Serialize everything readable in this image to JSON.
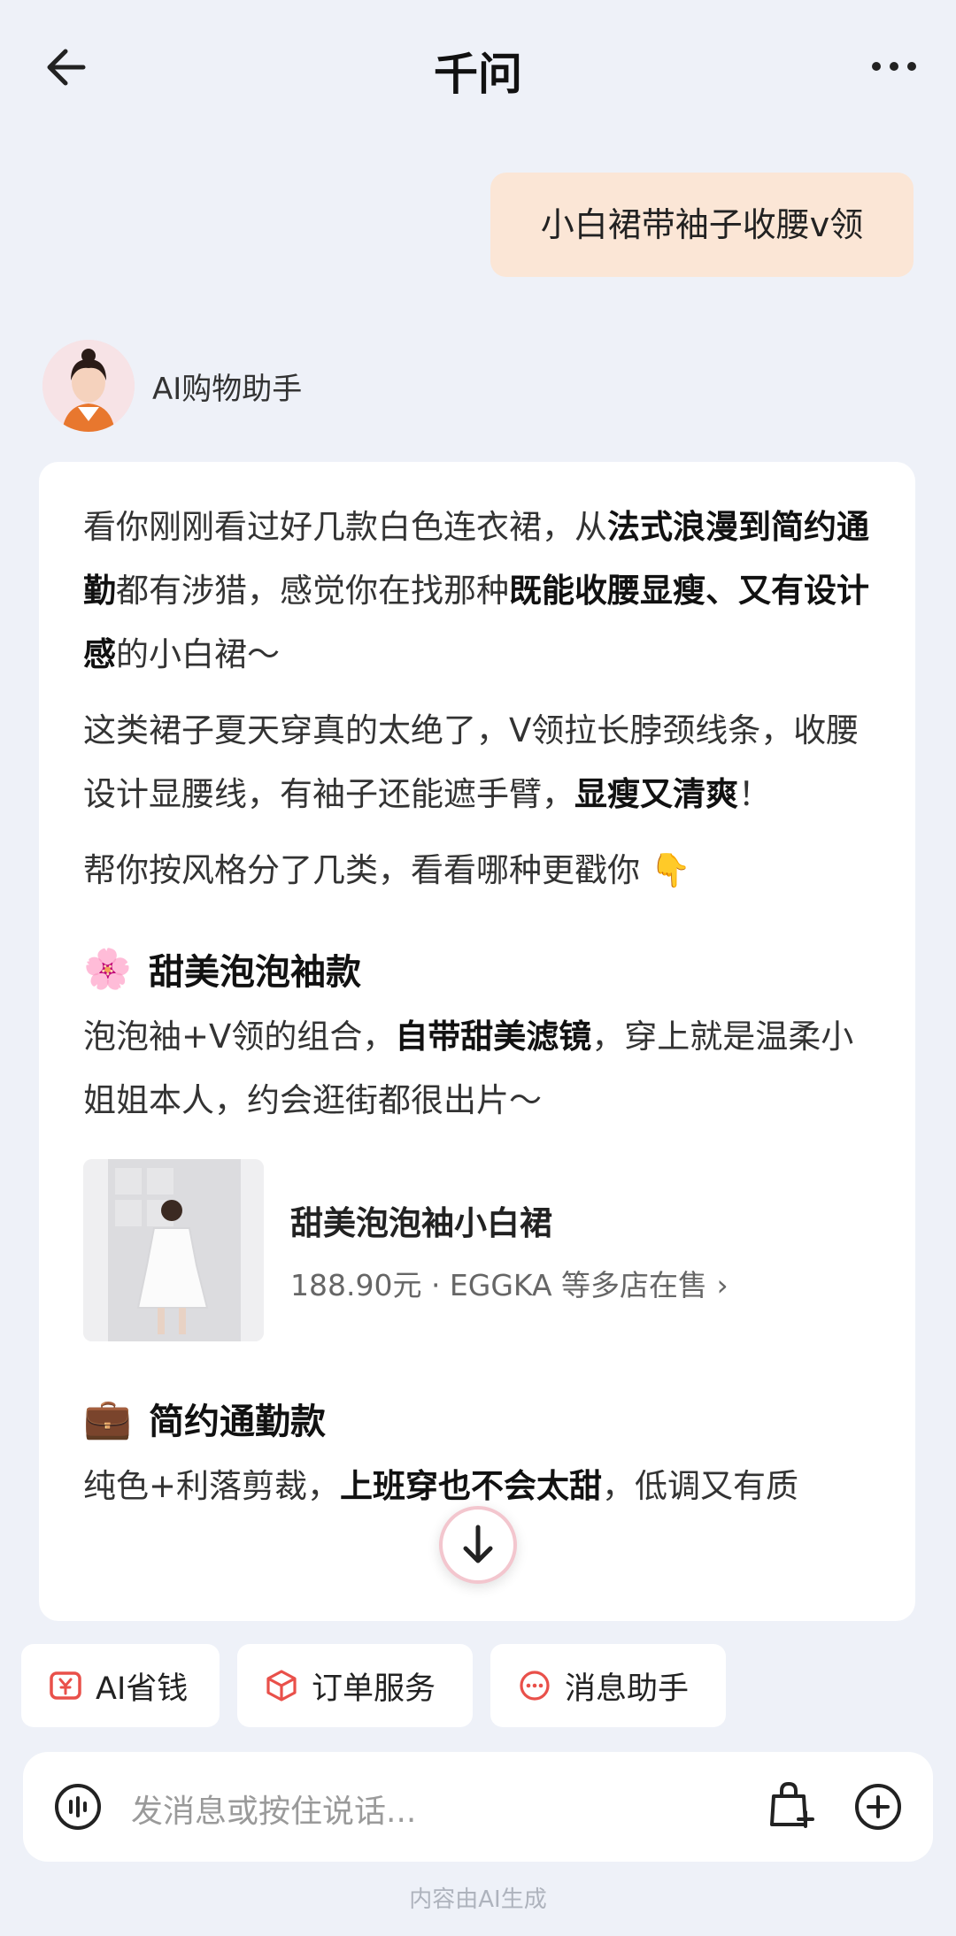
{
  "header": {
    "title": "千问"
  },
  "chat": {
    "user_message": "小白裙带袖子收腰v领",
    "assistant_name": "AI购物助手"
  },
  "reply": {
    "p1": {
      "a": "看你刚刚看过好几款白色连衣裙，从",
      "b": "法式浪漫到简约通勤",
      "c": "都有涉猎，感觉你在找那种",
      "d": "既能收腰显瘦、又有设计感",
      "e": "的小白裙～"
    },
    "p2": {
      "a": "这类裙子夏天穿真的太绝了，V领拉长脖颈线条，收腰设计显腰线，有袖子还能遮手臂，",
      "b": "显瘦又清爽",
      "c": "！"
    },
    "p3": {
      "a": "帮你按风格分了几类，看看哪种更戳你",
      "emoji": "👇"
    },
    "section1": {
      "emoji": "🌸",
      "title": "甜美泡泡袖款",
      "a": "泡泡袖+V领的组合，",
      "b": "自带甜美滤镜",
      "c": "，穿上就是温柔小姐姐本人，约会逛街都很出片～"
    },
    "product": {
      "name": "甜美泡泡袖小白裙",
      "meta": "188.90元 · EGGKA 等多店在售 ›"
    },
    "section2": {
      "emoji": "💼",
      "title": "简约通勤款",
      "a": "纯色+利落剪裁，",
      "b": "上班穿也不会太甜",
      "c": "，低调又有质"
    }
  },
  "quick_actions": [
    {
      "label": "AI省钱",
      "icon": "money-icon"
    },
    {
      "label": "订单服务",
      "icon": "box-icon"
    },
    {
      "label": "消息助手",
      "icon": "chat-icon"
    }
  ],
  "input": {
    "placeholder": "发消息或按住说话..."
  },
  "footer": {
    "note": "内容由AI生成"
  },
  "colors": {
    "accent": "#e9504a",
    "user_bubble": "#fbe6d6",
    "background": "#eef1f8"
  }
}
